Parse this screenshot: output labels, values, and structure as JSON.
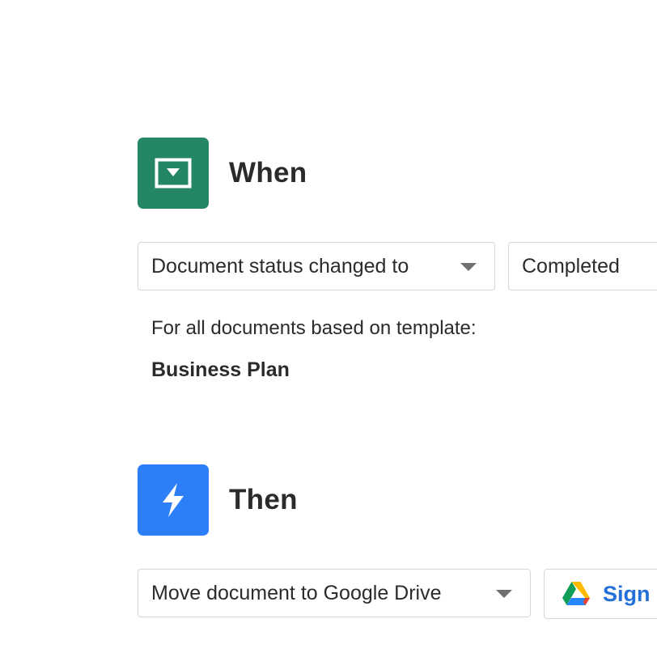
{
  "when": {
    "title": "When",
    "icon": "document-status-icon",
    "icon_color": "#248567",
    "trigger_select": {
      "value": "Document status changed to"
    },
    "status_select": {
      "value": "Completed"
    },
    "template_caption": "For all documents based on template:",
    "template_name": "Business Plan"
  },
  "then": {
    "title": "Then",
    "icon": "lightning-icon",
    "icon_color": "#2d7ff9",
    "action_select": {
      "value": "Move document to Google Drive"
    },
    "sign_button": {
      "label": "Sign",
      "icon": "google-drive-icon",
      "label_color": "#2370d8"
    }
  }
}
